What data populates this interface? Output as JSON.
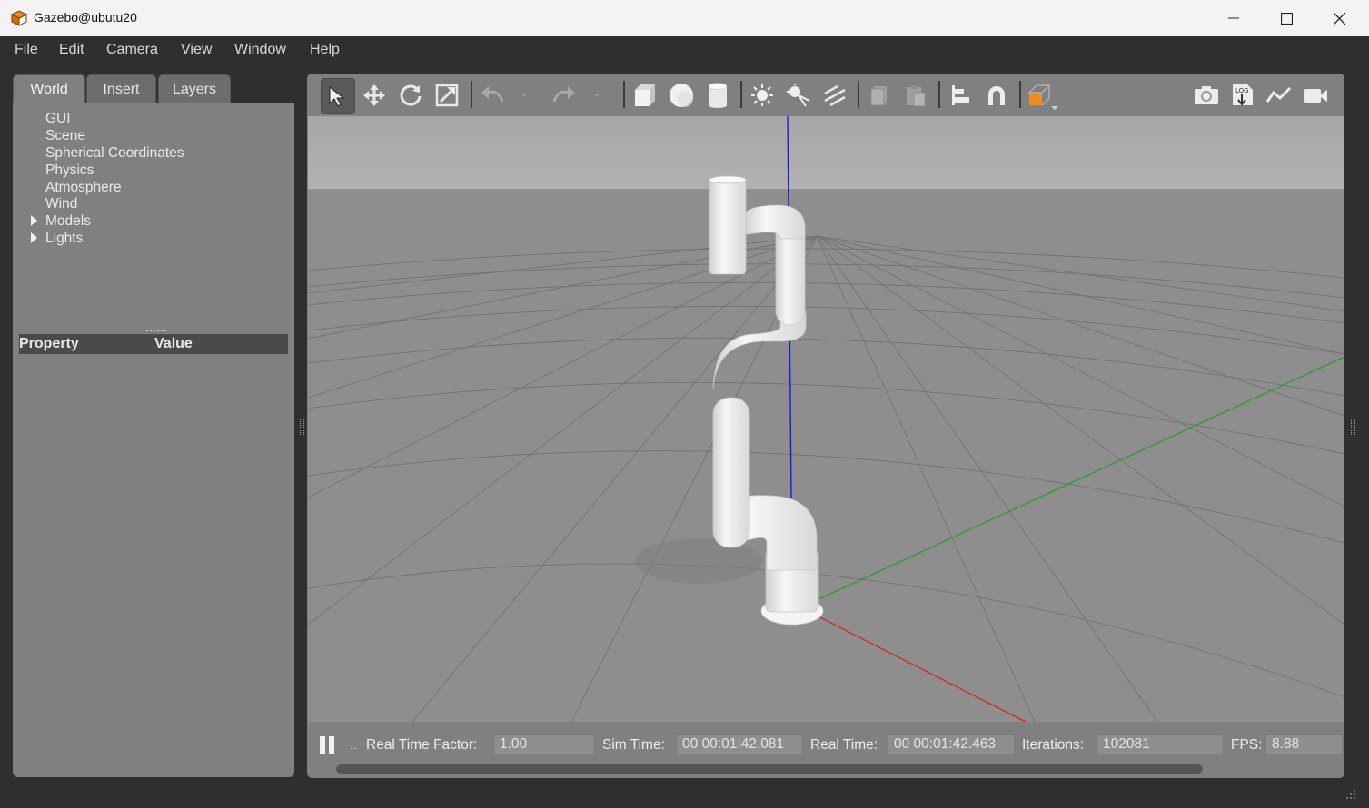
{
  "window": {
    "title": "Gazebo@ubutu20"
  },
  "menu": {
    "items": [
      {
        "label": "File"
      },
      {
        "label": "Edit"
      },
      {
        "label": "Camera"
      },
      {
        "label": "View"
      },
      {
        "label": "Window"
      },
      {
        "label": "Help"
      }
    ]
  },
  "left_panel": {
    "tabs": [
      {
        "label": "World",
        "active": true
      },
      {
        "label": "Insert",
        "active": false
      },
      {
        "label": "Layers",
        "active": false
      }
    ],
    "tree": [
      {
        "label": "GUI",
        "expandable": false
      },
      {
        "label": "Scene",
        "expandable": false
      },
      {
        "label": "Spherical Coordinates",
        "expandable": false
      },
      {
        "label": "Physics",
        "expandable": false
      },
      {
        "label": "Atmosphere",
        "expandable": false
      },
      {
        "label": "Wind",
        "expandable": false
      },
      {
        "label": "Models",
        "expandable": true
      },
      {
        "label": "Lights",
        "expandable": true
      }
    ],
    "property_header": {
      "property": "Property",
      "value": "Value"
    }
  },
  "toolbar": {
    "tools": [
      "select-icon",
      "translate-icon",
      "rotate-icon",
      "scale-icon",
      "undo-icon",
      "redo-icon",
      "box-icon",
      "sphere-icon",
      "cylinder-icon",
      "point-light-icon",
      "spot-light-icon",
      "directional-light-icon",
      "copy-icon",
      "paste-icon",
      "align-icon",
      "snap-icon",
      "view-angle-icon",
      "screenshot-icon",
      "log-icon",
      "plot-icon",
      "record-video-icon"
    ],
    "accent": "#f28a1c"
  },
  "status": {
    "rtf_label": "Real Time Factor:",
    "rtf_value": "1.00",
    "sim_label": "Sim Time:",
    "sim_value": "00 00:01:42.081",
    "real_label": "Real Time:",
    "real_value": "00 00:01:42.463",
    "iter_label": "Iterations:",
    "iter_value": "102081",
    "fps_label": "FPS:",
    "fps_value": "8.88"
  },
  "colors": {
    "sky": "#ababab",
    "ground": "#8c8c8c",
    "x_axis": "#e02020",
    "y_axis": "#2a9a2a",
    "z_axis": "#2020d0"
  }
}
